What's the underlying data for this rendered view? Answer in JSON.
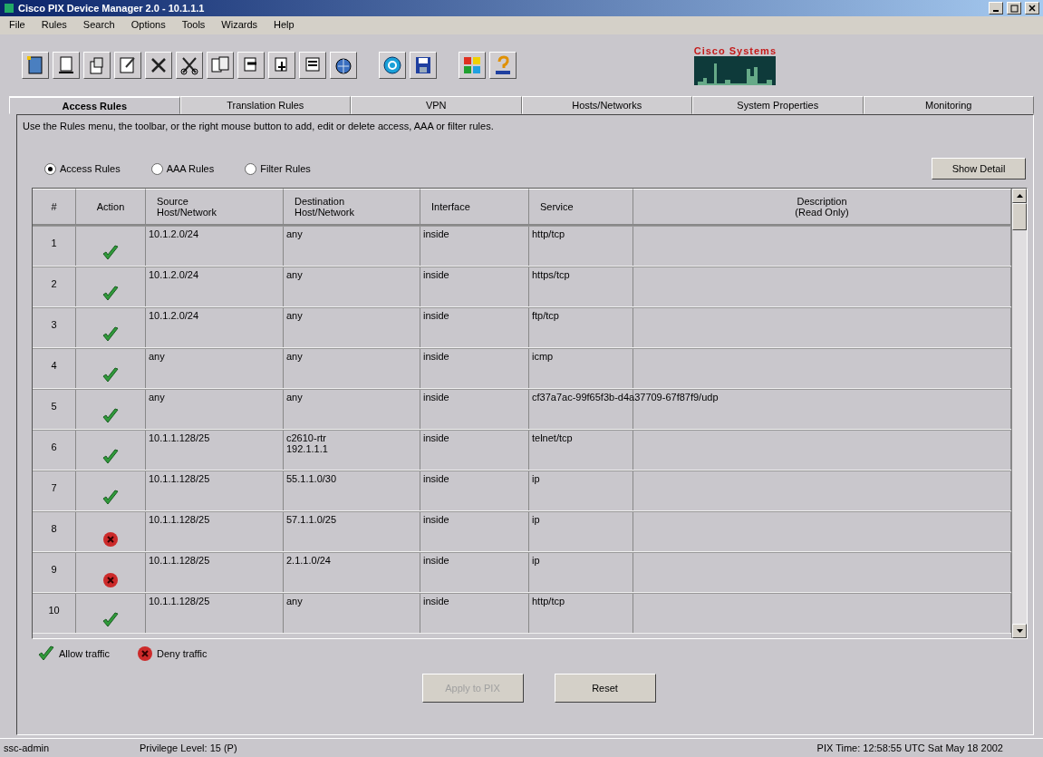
{
  "window": {
    "title": "Cisco PIX Device Manager 2.0 - 10.1.1.1"
  },
  "menu": [
    "File",
    "Rules",
    "Search",
    "Options",
    "Tools",
    "Wizards",
    "Help"
  ],
  "logo": {
    "text": "Cisco Systems"
  },
  "tabs": [
    {
      "label": "Access Rules",
      "selected": true
    },
    {
      "label": "Translation Rules",
      "selected": false
    },
    {
      "label": "VPN",
      "selected": false
    },
    {
      "label": "Hosts/Networks",
      "selected": false
    },
    {
      "label": "System Properties",
      "selected": false
    },
    {
      "label": "Monitoring",
      "selected": false
    }
  ],
  "instructions": "Use the Rules menu, the toolbar, or the right mouse button to add, edit or delete access, AAA or filter rules.",
  "rule_types": [
    {
      "label": "Access Rules",
      "selected": true
    },
    {
      "label": "AAA Rules",
      "selected": false
    },
    {
      "label": "Filter Rules",
      "selected": false
    }
  ],
  "show_detail_button": "Show Detail",
  "table": {
    "columns": [
      [
        "#"
      ],
      [
        "Action"
      ],
      [
        "Source",
        "Host/Network"
      ],
      [
        "Destination",
        "Host/Network"
      ],
      [
        "Interface"
      ],
      [
        "Service"
      ],
      [
        "Description",
        "(Read Only)"
      ]
    ],
    "rows": [
      {
        "number": "1",
        "kind": "allow",
        "source": "10.1.2.0/24",
        "destination": [
          "any"
        ],
        "interface": "inside",
        "service": "http/tcp"
      },
      {
        "number": "2",
        "kind": "allow",
        "source": "10.1.2.0/24",
        "destination": [
          "any"
        ],
        "interface": "inside",
        "service": "https/tcp"
      },
      {
        "number": "3",
        "kind": "allow",
        "source": "10.1.2.0/24",
        "destination": [
          "any"
        ],
        "interface": "inside",
        "service": "ftp/tcp"
      },
      {
        "number": "4",
        "kind": "allow",
        "source": "any",
        "destination": [
          "any"
        ],
        "interface": "inside",
        "service": "icmp"
      },
      {
        "number": "5",
        "kind": "allow",
        "source": "any",
        "destination": [
          "any"
        ],
        "interface": "inside",
        "service": "cf37a7ac-99f65f3b-d4a37709-67f87f9/udp"
      },
      {
        "number": "6",
        "kind": "allow",
        "source": "10.1.1.128/25",
        "destination": [
          "c2610-rtr",
          "192.1.1.1"
        ],
        "interface": "inside",
        "service": "telnet/tcp"
      },
      {
        "number": "7",
        "kind": "allow",
        "source": "10.1.1.128/25",
        "destination": [
          "55.1.1.0/30"
        ],
        "interface": "inside",
        "service": "ip"
      },
      {
        "number": "8",
        "kind": "deny",
        "source": "10.1.1.128/25",
        "destination": [
          "57.1.1.0/25"
        ],
        "interface": "inside",
        "service": "ip"
      },
      {
        "number": "9",
        "kind": "deny",
        "source": "10.1.1.128/25",
        "destination": [
          "2.1.1.0/24"
        ],
        "interface": "inside",
        "service": "ip"
      },
      {
        "number": "10",
        "kind": "allow",
        "source": "10.1.1.128/25",
        "destination": [
          "any"
        ],
        "interface": "inside",
        "service": "http/tcp"
      }
    ]
  },
  "legend": [
    {
      "kind": "allow",
      "label": "Allow traffic"
    },
    {
      "kind": "deny",
      "label": "Deny traffic"
    }
  ],
  "buttons": [
    {
      "label": "Apply to PIX",
      "disabled": true
    },
    {
      "label": "Reset",
      "disabled": false
    }
  ],
  "status_bar": {
    "user": "ssc-admin",
    "privilege": "Privilege Level: 15 (P)",
    "time": "PIX Time: 12:58:55 UTC Sat May 18 2002"
  }
}
